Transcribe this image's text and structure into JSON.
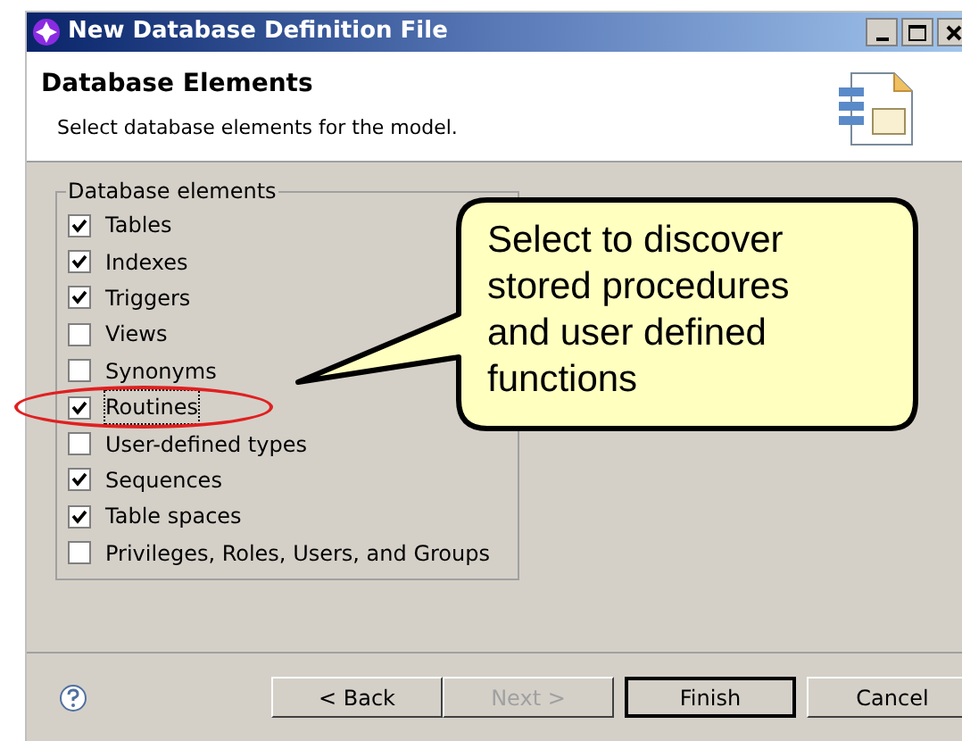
{
  "window": {
    "title": "New Database Definition File"
  },
  "header": {
    "title": "Database Elements",
    "subtitle": "Select database elements for the model."
  },
  "group": {
    "label": "Database elements",
    "items": [
      {
        "label": "Tables",
        "checked": true
      },
      {
        "label": "Indexes",
        "checked": true
      },
      {
        "label": "Triggers",
        "checked": true
      },
      {
        "label": "Views",
        "checked": false
      },
      {
        "label": "Synonyms",
        "checked": false
      },
      {
        "label": "Routines",
        "checked": true,
        "highlighted": true
      },
      {
        "label": "User-defined types",
        "checked": false
      },
      {
        "label": "Sequences",
        "checked": true
      },
      {
        "label": "Table spaces",
        "checked": true
      },
      {
        "label": "Privileges, Roles, Users, and Groups",
        "checked": false
      }
    ]
  },
  "callout": {
    "text": "Select to discover stored procedures and user defined functions"
  },
  "buttons": [
    {
      "label": "< Back",
      "disabled": false,
      "default": false
    },
    {
      "label": "Next >",
      "disabled": true,
      "default": false
    },
    {
      "label": "Finish",
      "disabled": false,
      "default": true
    },
    {
      "label": "Cancel",
      "disabled": false,
      "default": false
    }
  ]
}
